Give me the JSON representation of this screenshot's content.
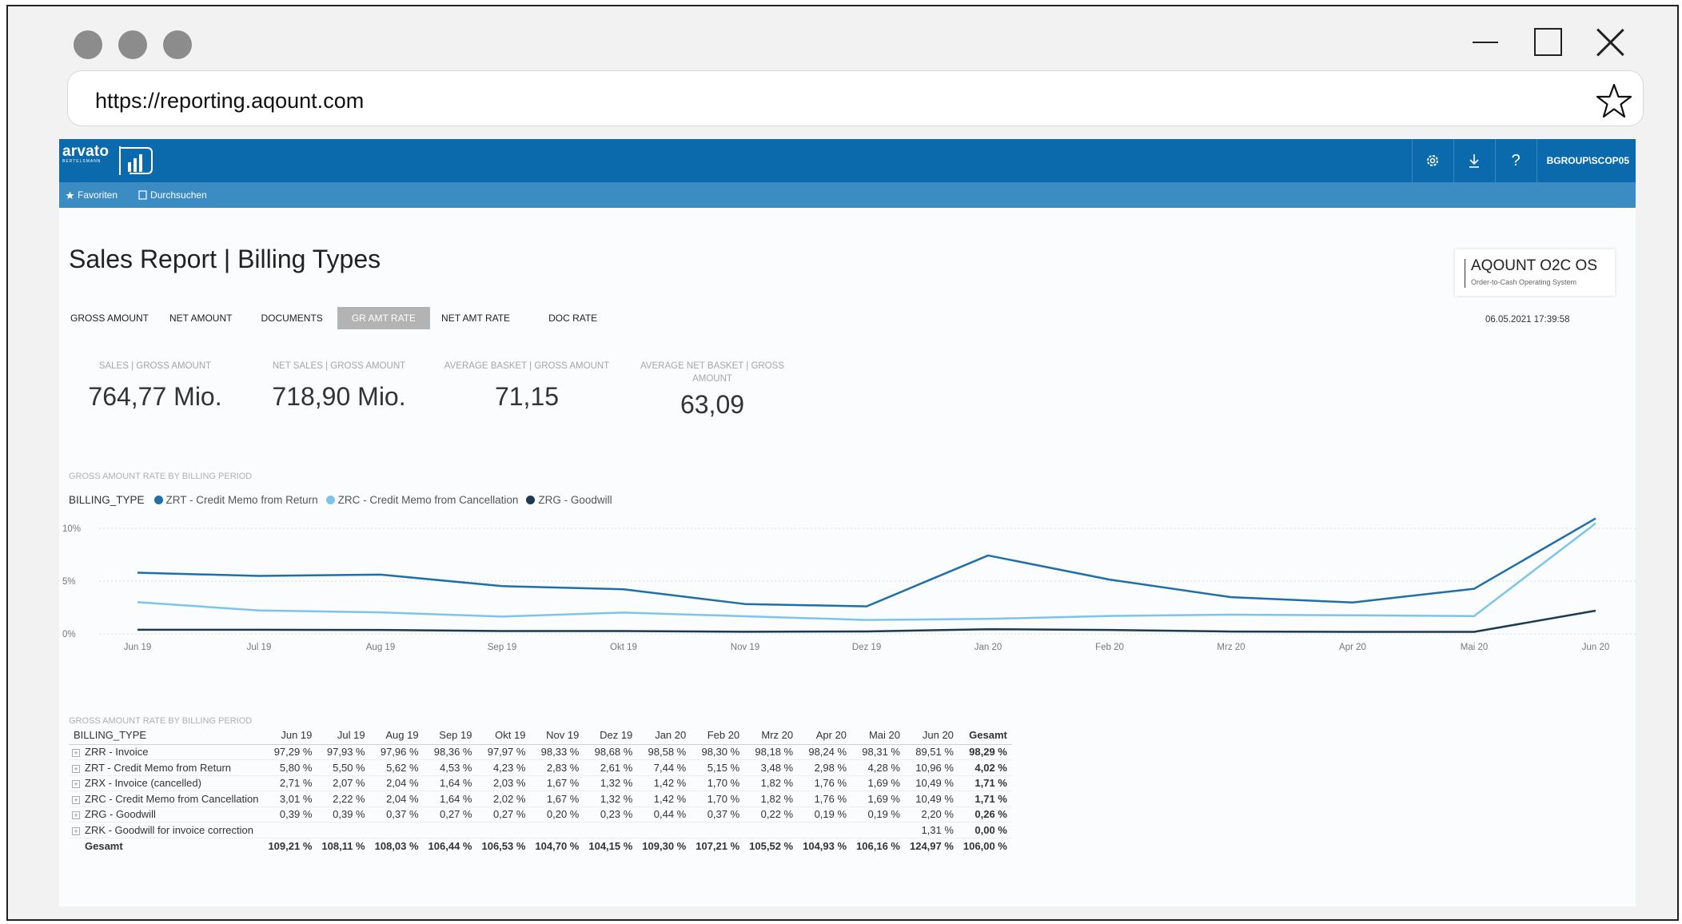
{
  "browser": {
    "url": "https://reporting.aqount.com"
  },
  "app": {
    "logo_text": "arvato",
    "logo_sub": "BERTELSMANN",
    "user": "BGROUP\\SCOP05",
    "help_label": "?",
    "nav": {
      "favorites": "Favoriten",
      "browse": "Durchsuchen"
    }
  },
  "report": {
    "title": "Sales Report | Billing Types",
    "brand_title": "AQOUNT O2C OS",
    "brand_subtitle": "Order-to-Cash Operating System",
    "timestamp": "06.05.2021 17:39:58",
    "tabs": [
      "GROSS AMOUNT",
      "NET AMOUNT",
      "DOCUMENTS",
      "GR AMT RATE",
      "NET AMT RATE",
      "DOC RATE"
    ],
    "active_tab": "GR AMT RATE",
    "kpis": [
      {
        "label": "SALES | GROSS AMOUNT",
        "value": "764,77 Mio."
      },
      {
        "label": "NET SALES | GROSS AMOUNT",
        "value": "718,90 Mio."
      },
      {
        "label": "AVERAGE BASKET | GROSS AMOUNT",
        "value": "71,15"
      },
      {
        "label": "AVERAGE NET BASKET | GROSS AMOUNT",
        "value": "63,09"
      }
    ],
    "chart_section_label": "GROSS AMOUNT RATE BY BILLING PERIOD",
    "table_section_label": "GROSS AMOUNT RATE BY BILLING PERIOD"
  },
  "chart_data": {
    "type": "line",
    "title": "GROSS AMOUNT RATE BY BILLING PERIOD",
    "legend_title": "BILLING_TYPE",
    "x": [
      "Jun 19",
      "Jul 19",
      "Aug 19",
      "Sep 19",
      "Okt 19",
      "Nov 19",
      "Dez 19",
      "Jan 20",
      "Feb 20",
      "Mrz 20",
      "Apr 20",
      "Mai 20",
      "Jun 20"
    ],
    "y_ticks": [
      "0%",
      "5%",
      "10%"
    ],
    "ylim": [
      0,
      11
    ],
    "grid": true,
    "legend_position": "top-left",
    "series": [
      {
        "name": "ZRT - Credit Memo from Return",
        "color": "#1f6fa8",
        "values": [
          5.8,
          5.5,
          5.62,
          4.53,
          4.23,
          2.83,
          2.61,
          7.44,
          5.15,
          3.48,
          2.98,
          4.28,
          10.96
        ]
      },
      {
        "name": "ZRC - Credit Memo from Cancellation",
        "color": "#7dc4ec",
        "values": [
          3.01,
          2.22,
          2.04,
          1.64,
          2.02,
          1.67,
          1.32,
          1.42,
          1.7,
          1.82,
          1.76,
          1.69,
          10.49
        ]
      },
      {
        "name": "ZRG - Goodwill",
        "color": "#1b3a55",
        "values": [
          0.39,
          0.39,
          0.37,
          0.27,
          0.27,
          0.2,
          0.23,
          0.44,
          0.37,
          0.22,
          0.19,
          0.19,
          2.2
        ]
      }
    ]
  },
  "table": {
    "header_first": "BILLING_TYPE",
    "columns": [
      "Jun 19",
      "Jul 19",
      "Aug 19",
      "Sep 19",
      "Okt 19",
      "Nov 19",
      "Dez 19",
      "Jan 20",
      "Feb 20",
      "Mrz 20",
      "Apr 20",
      "Mai 20",
      "Jun 20",
      "Gesamt"
    ],
    "rows": [
      {
        "label": "ZRR - Invoice",
        "values": [
          "97,29 %",
          "97,93 %",
          "97,96 %",
          "98,36 %",
          "97,97 %",
          "98,33 %",
          "98,68 %",
          "98,58 %",
          "98,30 %",
          "98,18 %",
          "98,24 %",
          "98,31 %",
          "89,51 %",
          "98,29 %"
        ]
      },
      {
        "label": "ZRT - Credit Memo from Return",
        "values": [
          "5,80 %",
          "5,50 %",
          "5,62 %",
          "4,53 %",
          "4,23 %",
          "2,83 %",
          "2,61 %",
          "7,44 %",
          "5,15 %",
          "3,48 %",
          "2,98 %",
          "4,28 %",
          "10,96 %",
          "4,02 %"
        ]
      },
      {
        "label": "ZRX - Invoice (cancelled)",
        "values": [
          "2,71 %",
          "2,07 %",
          "2,04 %",
          "1,64 %",
          "2,03 %",
          "1,67 %",
          "1,32 %",
          "1,42 %",
          "1,70 %",
          "1,82 %",
          "1,76 %",
          "1,69 %",
          "10,49 %",
          "1,71 %"
        ]
      },
      {
        "label": "ZRC - Credit Memo from Cancellation",
        "values": [
          "3,01 %",
          "2,22 %",
          "2,04 %",
          "1,64 %",
          "2,02 %",
          "1,67 %",
          "1,32 %",
          "1,42 %",
          "1,70 %",
          "1,82 %",
          "1,76 %",
          "1,69 %",
          "10,49 %",
          "1,71 %"
        ]
      },
      {
        "label": "ZRG - Goodwill",
        "values": [
          "0,39 %",
          "0,39 %",
          "0,37 %",
          "0,27 %",
          "0,27 %",
          "0,20 %",
          "0,23 %",
          "0,44 %",
          "0,37 %",
          "0,22 %",
          "0,19 %",
          "0,19 %",
          "2,20 %",
          "0,26 %"
        ]
      },
      {
        "label": "ZRK - Goodwill for invoice correction",
        "values": [
          "",
          "",
          "",
          "",
          "",
          "",
          "",
          "",
          "",
          "",
          "",
          "",
          "1,31 %",
          "0,00 %"
        ]
      }
    ],
    "total": {
      "label": "Gesamt",
      "values": [
        "109,21 %",
        "108,11 %",
        "108,03 %",
        "106,44 %",
        "106,53 %",
        "104,70 %",
        "104,15 %",
        "109,30 %",
        "107,21 %",
        "105,52 %",
        "104,93 %",
        "106,16 %",
        "124,97 %",
        "106,00 %"
      ]
    }
  }
}
